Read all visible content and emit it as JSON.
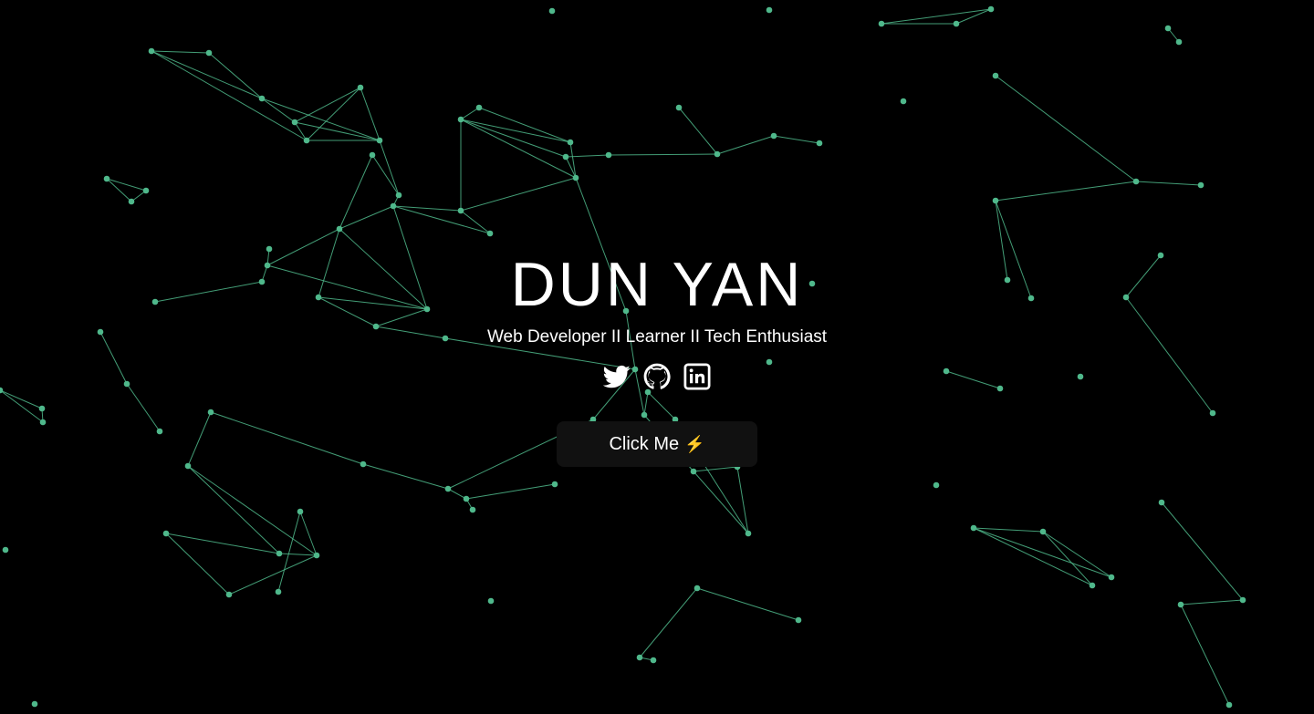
{
  "hero": {
    "name": "DUN YAN",
    "tagline": "Web Developer II Learner II Tech Enthusiast"
  },
  "social": [
    {
      "icon": "twitter-icon",
      "label": "Twitter"
    },
    {
      "icon": "github-icon",
      "label": "GitHub"
    },
    {
      "icon": "linkedin-icon",
      "label": "LinkedIn"
    }
  ],
  "cta": {
    "label": "Click Me",
    "emoji": "⚡"
  },
  "colors": {
    "background": "#000000",
    "particle": "#4fb88b",
    "text": "#ffffff",
    "button": "#111111"
  }
}
